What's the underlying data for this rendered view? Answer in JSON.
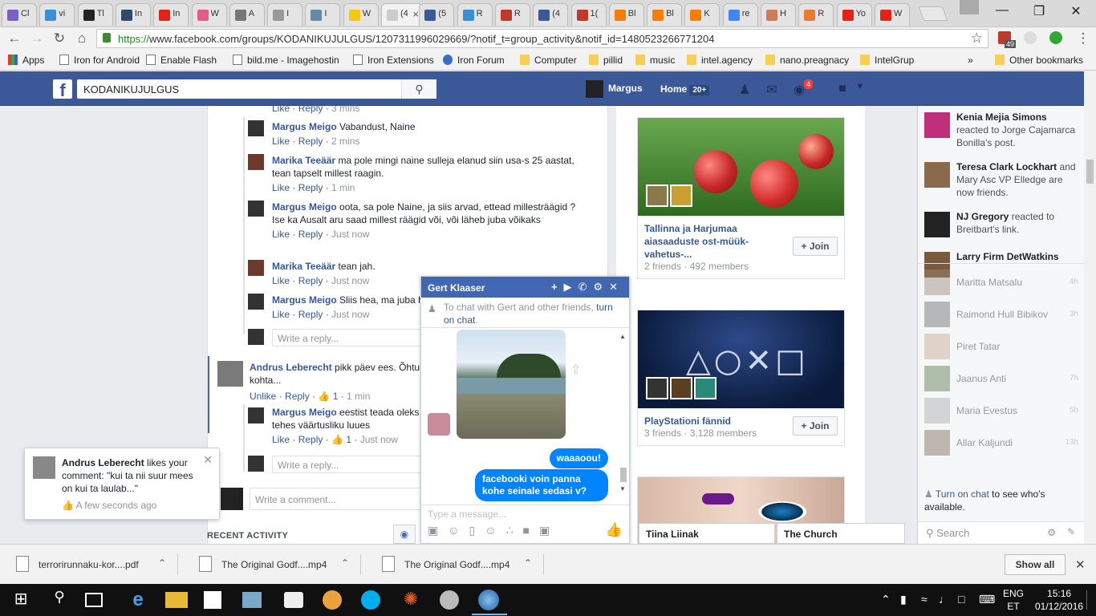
{
  "browser": {
    "tabs": [
      {
        "title": "Cl",
        "color": "#7b5fc9"
      },
      {
        "title": "vi",
        "color": "#3a8fd6"
      },
      {
        "title": "Tl",
        "color": "#222222"
      },
      {
        "title": "In",
        "color": "#2d4a6b"
      },
      {
        "title": "In",
        "color": "#e62117"
      },
      {
        "title": "W",
        "color": "#e65b88"
      },
      {
        "title": "A",
        "color": "#777777"
      },
      {
        "title": "I",
        "color": "#999999"
      },
      {
        "title": "I",
        "color": "#6688aa"
      },
      {
        "title": "W",
        "color": "#f2c811"
      },
      {
        "title": "(4",
        "color": "#cccccc"
      },
      {
        "title": "(5",
        "color": "#3b5998"
      },
      {
        "title": "R",
        "color": "#3a8fd6"
      },
      {
        "title": "R",
        "color": "#c0392b"
      },
      {
        "title": "(4",
        "color": "#3b5998"
      },
      {
        "title": "1(",
        "color": "#c0392b"
      },
      {
        "title": "Bl",
        "color": "#f57d00"
      },
      {
        "title": "Bl",
        "color": "#f57d00"
      },
      {
        "title": "K",
        "color": "#f57d00"
      },
      {
        "title": "re",
        "color": "#4285f4"
      },
      {
        "title": "H",
        "color": "#d17b58"
      },
      {
        "title": "R",
        "color": "#e87e2d"
      },
      {
        "title": "Yo",
        "color": "#e62117"
      },
      {
        "title": "W",
        "color": "#e62117"
      }
    ],
    "url_scheme": "https://",
    "url_rest": "www.facebook.com/groups/KODANIKUJULGUS/1207311996029669/?notif_t=group_activity&notif_id=1480523266771204",
    "ext_badge": "49",
    "bookmarks": [
      {
        "label": "Apps",
        "kind": "apps"
      },
      {
        "label": "Iron for Android",
        "kind": "page"
      },
      {
        "label": "Enable Flash",
        "kind": "page"
      },
      {
        "label": "bild.me - Imagehostin",
        "kind": "page"
      },
      {
        "label": "Iron Extensions",
        "kind": "page"
      },
      {
        "label": "Iron Forum",
        "kind": "globe"
      },
      {
        "label": "Computer",
        "kind": "folder"
      },
      {
        "label": "pillid",
        "kind": "folder"
      },
      {
        "label": "music",
        "kind": "folder"
      },
      {
        "label": "intel.agency",
        "kind": "folder"
      },
      {
        "label": "nano.preagnacy",
        "kind": "folder"
      },
      {
        "label": "IntelGrup",
        "kind": "folder"
      },
      {
        "label": "Other bookmarks",
        "kind": "folder"
      }
    ],
    "overflow": "»"
  },
  "fb": {
    "search_value": "KODANIKUJULGUS",
    "user_name": "Margus",
    "home_label": "Home",
    "home_count": "20+",
    "notif_badge": "4"
  },
  "feed": {
    "top_partial": {
      "like": "Like",
      "reply": "Reply",
      "time": "3 mins"
    },
    "replies": [
      {
        "name": "Margus Meigo",
        "text": "Vabandust, Naine",
        "like": "Like",
        "reply": "Reply",
        "time": "2 mins",
        "av": "#333333"
      },
      {
        "name": "Marika Teeäär",
        "text": "ma pole mingi naine sulleja elanud siin usa-s 25 aastat, tean tapselt millest raagin.",
        "like": "Like",
        "reply": "Reply",
        "time": "1 min",
        "av": "#6b3a2a"
      },
      {
        "name": "Margus Meigo",
        "text": "oota, sa pole Naine, ja siis arvad, ettead millesträägid ?",
        "text2": "Ise ka Ausalt aru saad millest räägid või, või läheb juba võikaks",
        "like": "Like",
        "reply": "Reply",
        "time": "Just now",
        "av": "#333333"
      },
      {
        "name": "Marika Teeäär",
        "text": "tean jah.",
        "like": "Like",
        "reply": "Reply",
        "time": "Just now",
        "av": "#6b3a2a"
      },
      {
        "name": "Margus Meigo",
        "text": "Sliis hea, ma juba h",
        "like": "Like",
        "reply": "Reply",
        "time": "Just now",
        "av": "#333333"
      }
    ],
    "write_reply": "Write a reply...",
    "comment": {
      "name": "Andrus Leberecht",
      "text": "pikk päev ees. Õhtul",
      "text2": "kohta...",
      "unlike": "Unlike",
      "reply": "Reply",
      "likes": "1",
      "time": "1 min"
    },
    "reply2": {
      "name": "Margus Meigo",
      "text": "eestist teada oleks",
      "text2": "tehes väärtusliku luues",
      "like": "Like",
      "reply": "Reply",
      "likes": "1",
      "time": "Just now"
    },
    "write_reply2": "Write a reply...",
    "write_comment": "Write a comment...",
    "recent_activity": "RECENT ACTIVITY"
  },
  "groups": [
    {
      "name": "Tallinna ja Harjumaa aiasaaduste ost-müük-vahetus-...",
      "meta": "2 friends · 492 members",
      "join": "+ Join"
    },
    {
      "name": "PlayStationi fännid",
      "meta": "3 friends · 3,128 members",
      "join": "+ Join"
    }
  ],
  "ticker": [
    {
      "name": "Kenia Mejia Simons",
      "text": "reacted to Jorge Cajamarca Bonilla's post."
    },
    {
      "name": "Teresa Clark Lockhart",
      "text": "and Mary Asc VP Elledge are now friends."
    },
    {
      "name": "NJ Gregory",
      "text": "reacted to Breitbart's link."
    },
    {
      "name": "Larry Firm DetWatkins",
      "text": ""
    }
  ],
  "contacts": [
    {
      "name": "Maritta Matsalu",
      "time": "4h"
    },
    {
      "name": "Raimond Hull Bibikov",
      "time": "3h"
    },
    {
      "name": "Piret Tatar",
      "time": ""
    },
    {
      "name": "Jaanus Anti",
      "time": "7h"
    },
    {
      "name": "Maria Evestus",
      "time": "5h"
    },
    {
      "name": "Allar Kaljundi",
      "time": "13h"
    }
  ],
  "chatside": {
    "turn_on_link": "Turn on chat",
    "turn_on_rest": " to see who's available.",
    "search": "Search"
  },
  "chat_tabs": [
    "Tiina Liinak",
    "The Church"
  ],
  "chat": {
    "title": "Gert Klaaser",
    "notice_pre": "To chat with Gert and other friends, ",
    "notice_link": "turn on chat",
    "notice_post": ".",
    "msg1": "waaaoou!",
    "msg2": "facebooki voin panna kohe seinale sedasi v?",
    "input_placeholder": "Type a message..."
  },
  "notification": {
    "name": "Andrus Leberecht",
    "text": " likes your comment: \"kui ta nii suur mees on kui ta laulab...\"",
    "time": "A few seconds ago"
  },
  "downloads": [
    {
      "name": "terrorirunnaku-kor....pdf"
    },
    {
      "name": "The Original Godf....mp4"
    },
    {
      "name": "The Original Godf....mp4"
    }
  ],
  "show_all": "Show all",
  "taskbar": {
    "lang1": "ENG",
    "lang2": "ET",
    "time": "15:16",
    "date": "01/12/2016"
  }
}
